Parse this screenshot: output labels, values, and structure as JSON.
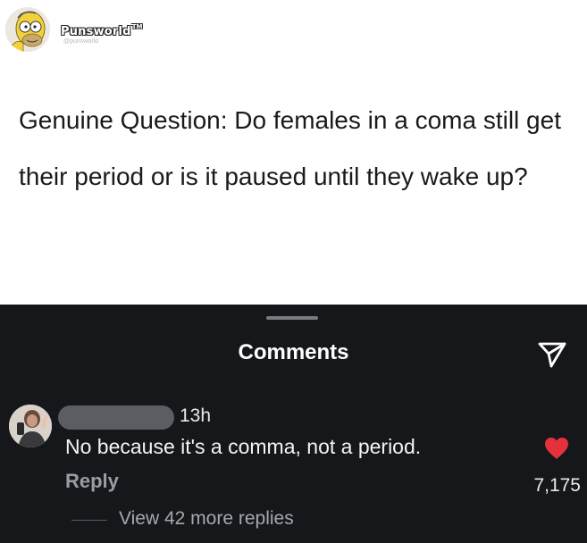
{
  "post": {
    "author": "Punsworld",
    "author_tm": "TM",
    "author_handle": "@punsworld",
    "avatar_icon": "cartoon-character-avatar-icon",
    "text": "Genuine Question:  Do females in a coma still get their period or is it paused until they wake up?"
  },
  "comments_panel": {
    "title": "Comments",
    "send_icon": "send-icon",
    "comment": {
      "author_redacted": true,
      "time": "13h",
      "text": "No because it's a comma, not a period.",
      "reply_label": "Reply",
      "likes": "7,175",
      "liked": true,
      "view_replies": "View 42 more replies"
    }
  },
  "colors": {
    "post_background": "#ffffff",
    "panel_background": "#16171b",
    "heart": "#e5313d",
    "muted_text": "#9b9ca1"
  }
}
